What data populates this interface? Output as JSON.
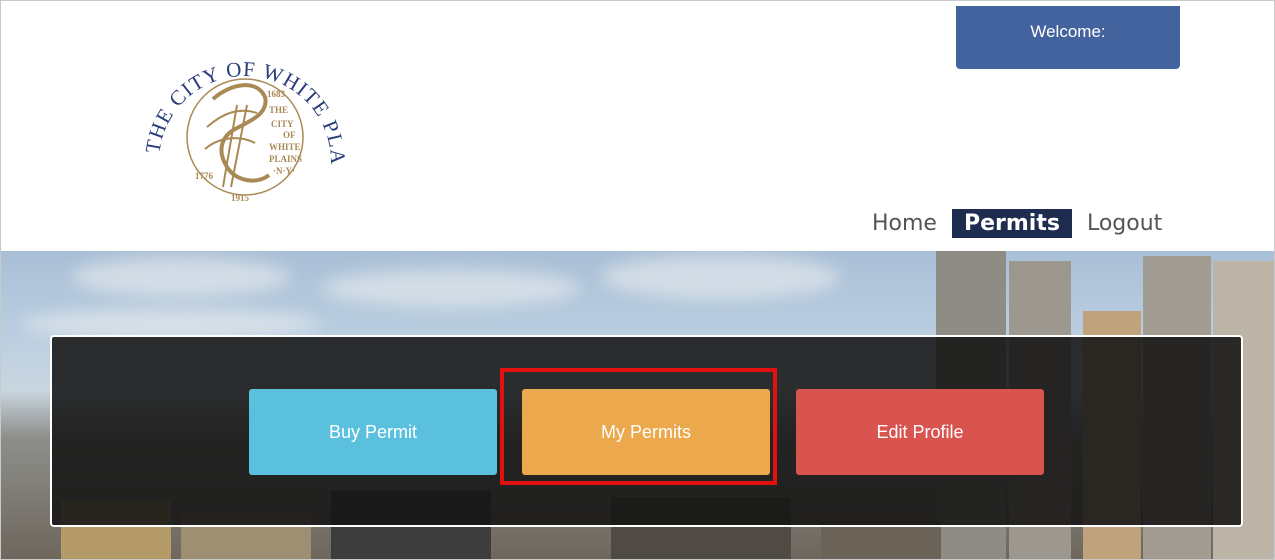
{
  "header": {
    "logo_text": "THE CITY OF WHITE PLAINS",
    "welcome_label": "Welcome:"
  },
  "nav": {
    "items": [
      {
        "label": "Home",
        "active": false
      },
      {
        "label": "Permits",
        "active": true
      },
      {
        "label": "Logout",
        "active": false
      }
    ]
  },
  "actions": {
    "buy_permit": "Buy Permit",
    "my_permits": "My Permits",
    "edit_profile": "Edit Profile"
  },
  "colors": {
    "welcome_bg": "#43639e",
    "nav_active_bg": "#1d2c4f",
    "buy_button": "#5bc0de",
    "my_permits_button": "#eca84c",
    "edit_profile_button": "#d9534f",
    "highlight_box": "#e31010",
    "seal": "#a98a55"
  }
}
